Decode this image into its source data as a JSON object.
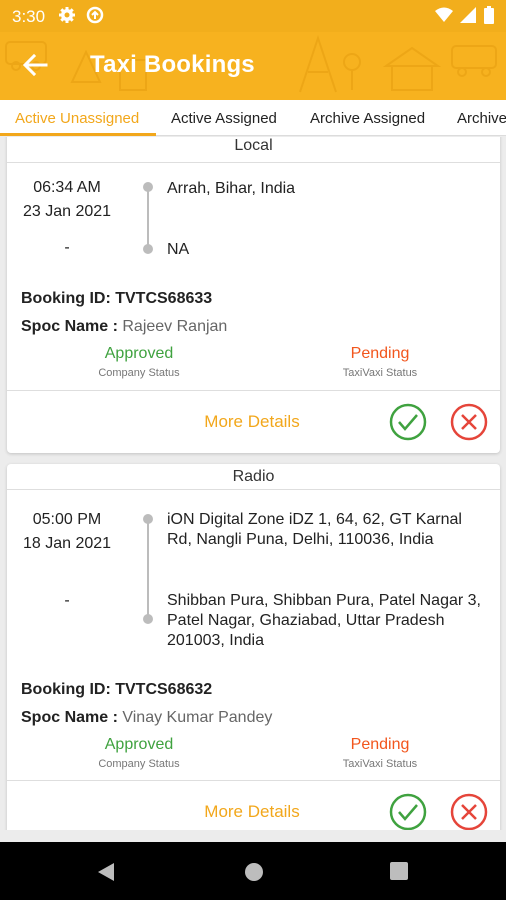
{
  "status_bar": {
    "time": "3:30",
    "left_icons": [
      "gear-icon",
      "sync-icon"
    ],
    "right_icons": [
      "wifi-icon",
      "signal-icon",
      "battery-icon"
    ]
  },
  "app_bar": {
    "title": "Taxi Bookings",
    "back_icon": "arrow-left-icon"
  },
  "tabs": [
    {
      "label": "Active Unassigned",
      "active": true
    },
    {
      "label": "Active Assigned",
      "active": false
    },
    {
      "label": "Archive Assigned",
      "active": false
    },
    {
      "label": "Archive",
      "active": false
    }
  ],
  "bookings": [
    {
      "type": "Local",
      "time": "06:34 AM",
      "date": "23 Jan 2021",
      "drop_time": "-",
      "pickup": "Arrah, Bihar, India",
      "drop": "NA",
      "booking_id_label": "Booking ID: ",
      "booking_id": "TVTCS68633",
      "spoc_label": "Spoc Name : ",
      "spoc_name": "Rajeev Ranjan",
      "company_status": "Approved",
      "company_status_label": "Company Status",
      "taxivaxi_status": "Pending",
      "taxivaxi_status_label": "TaxiVaxi Status",
      "more_details": "More Details"
    },
    {
      "type": "Radio",
      "time": "05:00 PM",
      "date": "18 Jan 2021",
      "drop_time": "-",
      "pickup": "iON Digital Zone iDZ 1, 64, 62, GT Karnal Rd, Nangli Puna, Delhi, 110036, India",
      "drop": "Shibban Pura, Shibban Pura, Patel Nagar 3, Patel Nagar, Ghaziabad, Uttar Pradesh 201003, India",
      "booking_id_label": "Booking ID: ",
      "booking_id": "TVTCS68632",
      "spoc_label": "Spoc Name : ",
      "spoc_name": "Vinay Kumar Pandey",
      "company_status": "Approved",
      "company_status_label": "Company Status",
      "taxivaxi_status": "Pending",
      "taxivaxi_status_label": "TaxiVaxi Status",
      "more_details": "More Details"
    }
  ],
  "colors": {
    "accent": "#f7b21f",
    "approved": "#3fa23f",
    "pending": "#f2561d",
    "accept": "#3fa23f",
    "reject": "#e5453a"
  }
}
